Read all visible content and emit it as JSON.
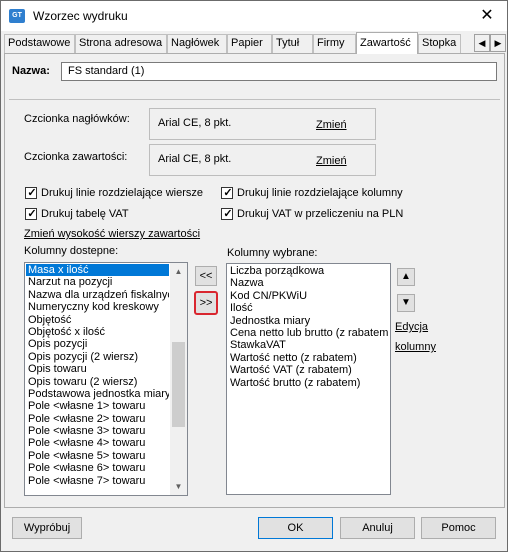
{
  "window": {
    "title": "Wzorzec wydruku",
    "icon_text": "GT"
  },
  "tabs": [
    "Podstawowe",
    "Strona adresowa",
    "Nagłówek",
    "Papier",
    "Tytuł",
    "Firmy",
    "Zawartość",
    "Stopka"
  ],
  "active_tab": "Zawartość",
  "form": {
    "name_label": "Nazwa:",
    "name_value": "FS standard (1)",
    "header_font_label": "Czcionka nagłówków:",
    "header_font_value": "Arial CE, 8 pkt.",
    "header_font_change": "Zmień",
    "content_font_label": "Czcionka zawartości:",
    "content_font_value": "Arial CE, 8 pkt.",
    "content_font_change": "Zmień"
  },
  "checkboxes": {
    "row_lines": {
      "label": "Drukuj linie rozdzielające wiersze",
      "checked": true
    },
    "col_lines": {
      "label": "Drukuj linie rozdzielające kolumny",
      "checked": true
    },
    "vat_table": {
      "label": "Drukuj tabelę VAT",
      "checked": true
    },
    "vat_pln": {
      "label": "Drukuj VAT w przeliczeniu na PLN",
      "checked": true
    }
  },
  "row_height_link": "Zmień wysokość wierszy zawartości",
  "available": {
    "label": "Kolumny dostepne:",
    "items": [
      "Masa x ilość",
      "Narzut na pozycji",
      "Nazwa dla urządzeń fiskalnych",
      "Numeryczny kod kreskowy",
      "Objętość",
      "Objętość x ilość",
      "Opis pozycji",
      "Opis pozycji (2 wiersz)",
      "Opis towaru",
      "Opis towaru (2 wiersz)",
      "Podstawowa jednostka miary",
      "Pole <własne 1> towaru",
      "Pole <własne 2> towaru",
      "Pole <własne 3> towaru",
      "Pole <własne 4> towaru",
      "Pole <własne 5> towaru",
      "Pole <własne 6> towaru",
      "Pole <własne 7> towaru"
    ],
    "selected": "Masa x ilość"
  },
  "move_left": "<<",
  "move_right": ">>",
  "chosen": {
    "label": "Kolumny wybrane:",
    "items": [
      "Liczba porządkowa",
      "Nazwa",
      "Kod CN/PKWiU",
      "Ilość",
      "Jednostka miary",
      "Cena netto lub brutto (z rabatem",
      "StawkaVAT",
      "Wartość netto (z rabatem)",
      "Wartość VAT (z rabatem)",
      "Wartość brutto (z rabatem)"
    ]
  },
  "edit_link_line1": "Edycja",
  "edit_link_line2": "kolumny",
  "buttons": {
    "test": "Wypróbuj",
    "ok": "OK",
    "cancel": "Anuluj",
    "help": "Pomoc"
  }
}
